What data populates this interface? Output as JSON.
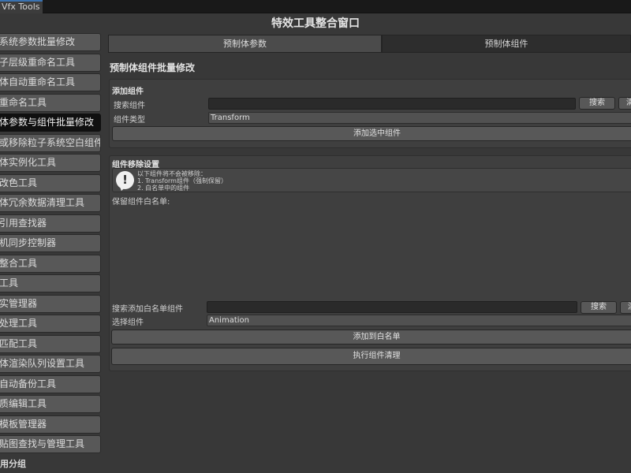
{
  "tab": {
    "label": "Vfx Tools"
  },
  "window_title": "特效工具整合窗口",
  "sidebar": {
    "items": [
      {
        "label": "系统参数批量修改"
      },
      {
        "label": "子层级重命名工具"
      },
      {
        "label": "体自动重命名工具"
      },
      {
        "label": "重命名工具"
      },
      {
        "label": "体参数与组件批量修改",
        "active": true
      },
      {
        "label": "或移除粒子系统空白组件"
      },
      {
        "label": "体实例化工具"
      },
      {
        "label": "改色工具"
      },
      {
        "label": "体冗余数据清理工具"
      },
      {
        "label": "引用查找器"
      },
      {
        "label": "机同步控制器"
      },
      {
        "label": "整合工具"
      },
      {
        "label": "工具"
      },
      {
        "label": "实管理器"
      },
      {
        "label": "处理工具"
      },
      {
        "label": "匹配工具"
      },
      {
        "label": "体渲染队列设置工具"
      },
      {
        "label": "自动备份工具"
      },
      {
        "label": "质编辑工具"
      },
      {
        "label": "模板管理器"
      },
      {
        "label": "贴图查找与管理工具"
      }
    ],
    "group_label": "用分组"
  },
  "main": {
    "tabs": [
      {
        "label": "预制体参数"
      },
      {
        "label": "预制体组件"
      }
    ],
    "section_title": "预制体组件批量修改",
    "add_component": {
      "header": "添加组件",
      "search_label": "搜索组件",
      "search_value": "",
      "search_button": "搜索",
      "clear_button": "清",
      "type_label": "组件类型",
      "type_value": "Transform",
      "add_button": "添加选中组件"
    },
    "remove_settings": {
      "header": "组件移除设置",
      "help_lines": [
        "以下组件将不会被移除：",
        "1. Transform组件（强制保留）",
        "2. 白名单中的组件"
      ],
      "whitelist_label": "保留组件白名单:",
      "search_label": "搜索添加白名单组件",
      "search_value": "",
      "search_button": "搜索",
      "clear_button": "清",
      "select_label": "选择组件",
      "select_value": "Animation",
      "add_whitelist_button": "添加到白名单",
      "run_button": "执行组件清理"
    }
  }
}
